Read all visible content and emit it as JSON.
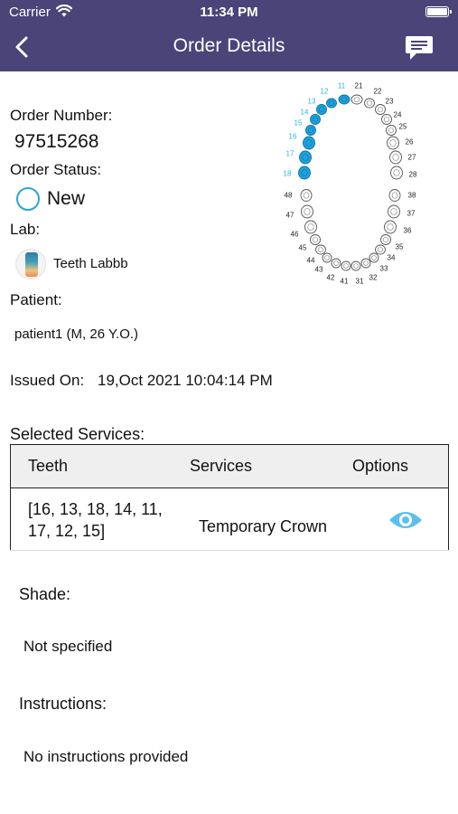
{
  "status_bar": {
    "carrier": "Carrier",
    "time": "11:34 PM"
  },
  "nav": {
    "title": "Order Details"
  },
  "order": {
    "number_label": "Order Number:",
    "number": "97515268",
    "status_label": "Order Status:",
    "status": "New",
    "lab_label": "Lab:",
    "lab_name": "Teeth Labbb",
    "patient_label": "Patient:",
    "patient": "patient1 (M, 26 Y.O.)",
    "issued_label": "Issued On:",
    "issued_value": "19,Oct 2021 10:04:14 PM"
  },
  "services": {
    "title": "Selected Services:",
    "headers": [
      "Teeth",
      "Services",
      "Options"
    ],
    "rows": [
      {
        "teeth_line1": "[16, 13, 18, 14, 11,",
        "teeth_line2": "17, 12, 15]",
        "service": "Temporary Crown"
      }
    ]
  },
  "shade": {
    "label": "Shade:",
    "value": "Not specified"
  },
  "instructions": {
    "label": "Instructions:",
    "value": "No instructions provided"
  },
  "teeth_chart": {
    "selected_teeth": [
      11,
      12,
      13,
      14,
      15,
      16,
      17,
      18
    ],
    "upper_right_numbers": [
      "11",
      "12",
      "13",
      "14",
      "15",
      "16",
      "17",
      "18"
    ],
    "upper_left_numbers": [
      "21",
      "22",
      "23",
      "24",
      "25",
      "26",
      "27",
      "28"
    ],
    "lower_left_numbers": [
      "31",
      "32",
      "33",
      "34",
      "35",
      "36",
      "37",
      "38"
    ],
    "lower_right_numbers": [
      "41",
      "42",
      "43",
      "44",
      "45",
      "46",
      "47",
      "48"
    ]
  },
  "colors": {
    "header_bg": "#4b4478",
    "accent": "#2ba3d9",
    "selected_tooth": "#1ea3e0",
    "selected_number": "#2bb0e8"
  },
  "icons": [
    "wifi-icon",
    "battery-icon",
    "back-chevron-icon",
    "chat-icon",
    "status-circle-icon",
    "eye-icon"
  ]
}
